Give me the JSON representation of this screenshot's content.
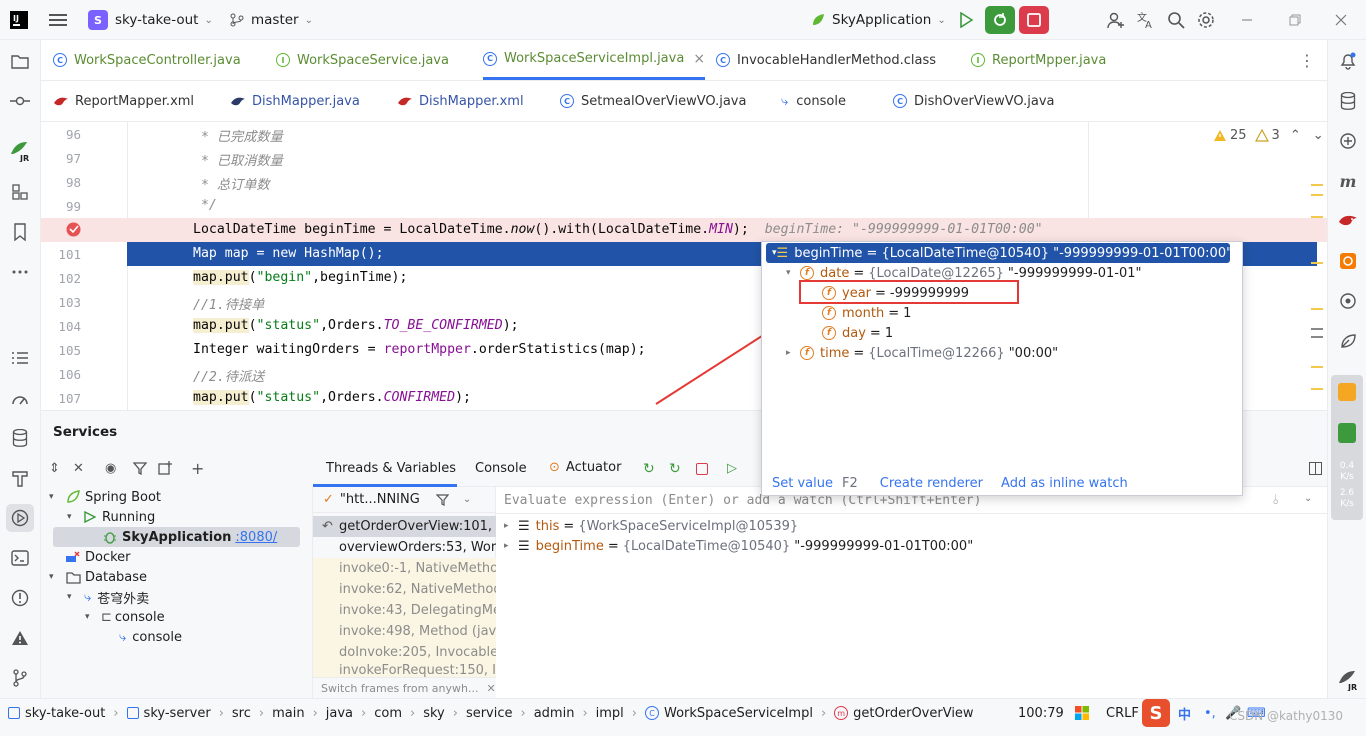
{
  "titlebar": {
    "project_badge": "S",
    "project_name": "sky-take-out",
    "branch": "master",
    "run_config": "SkyApplication"
  },
  "tabs_row1": [
    {
      "label": "WorkSpaceController.java",
      "icon": "class-icon"
    },
    {
      "label": "WorkSpaceService.java",
      "icon": "interface-icon"
    },
    {
      "label": "WorkSpaceServiceImpl.java",
      "icon": "class-icon",
      "active": true,
      "close": "×"
    },
    {
      "label": "InvocableHandlerMethod.class",
      "icon": "class-icon"
    },
    {
      "label": "ReportMpper.java",
      "icon": "interface-icon"
    }
  ],
  "tabs_row2": [
    {
      "label": "ReportMapper.xml",
      "icon": "mybatis-icon"
    },
    {
      "label": "DishMapper.java",
      "icon": "mybatis-icon"
    },
    {
      "label": "DishMapper.xml",
      "icon": "mybatis-icon"
    },
    {
      "label": "SetmealOverViewVO.java",
      "icon": "class-icon"
    },
    {
      "label": "console",
      "icon": "console-icon"
    },
    {
      "label": "DishOverViewVO.java",
      "icon": "class-icon"
    }
  ],
  "inspections": {
    "warnings": "25",
    "weak": "3"
  },
  "editor": {
    "line_numbers": [
      "96",
      "97",
      "98",
      "99",
      "",
      "101",
      "102",
      "103",
      "104",
      "105",
      "106",
      "107"
    ],
    "lines": {
      "l96": " * 已完成数量",
      "l97": " * 已取消数量",
      "l98": " * 总订单数",
      "l99": " */",
      "l100_a": "LocalDateTime beginTime = LocalDateTime.",
      "l100_now": "now",
      "l100_b": "().with(LocalDateTime.",
      "l100_min": "MIN",
      "l100_c": ");",
      "l100_inline": "beginTime: \"-999999999-01-01T00:00\"",
      "l101": "Map map = new HashMap();",
      "l102_put": "map.put",
      "l102_a": "(",
      "l102_str": "\"begin\"",
      "l102_b": ",beginTime);",
      "l103": "//1.待接单",
      "l104_put": "map.put",
      "l104_a": "(",
      "l104_str": "\"status\"",
      "l104_b": ",Orders.",
      "l104_c": "TO_BE_CONFIRMED",
      "l104_d": ");",
      "l105_a": "Integer waitingOrders = ",
      "l105_b": "reportMpper",
      "l105_c": ".orderStatistics(map);",
      "l106": "//2.待派送",
      "l107_put": "map.put",
      "l107_a": "(",
      "l107_str": "\"status\"",
      "l107_b": ",Orders.",
      "l107_c": "CONFIRMED",
      "l107_d": ");"
    }
  },
  "popup": {
    "root": "beginTime = {LocalDateTime@10540} \"-999999999-01-01T00:00\"",
    "date_name": "date",
    "date_type": "{LocalDate@12265}",
    "date_val": "\"-999999999-01-01\"",
    "year_name": "year",
    "year_val": "-999999999",
    "month_name": "month",
    "month_val": "1",
    "day_name": "day",
    "day_val": "1",
    "time_name": "time",
    "time_type": "{LocalTime@12266}",
    "time_val": "\"00:00\"",
    "eq": "=",
    "set_value": "Set value",
    "set_value_key": "F2",
    "create_renderer": "Create renderer",
    "add_inline": "Add as inline watch"
  },
  "services": {
    "title": "Services",
    "tree": {
      "spring_boot": "Spring Boot",
      "running": "Running",
      "app": "SkyApplication",
      "port": ":8080/",
      "docker": "Docker",
      "database": "Database",
      "ds": "苍穹外卖",
      "console_group": "console",
      "console": "console"
    }
  },
  "debugger": {
    "tab_threads": "Threads & Variables",
    "tab_console": "Console",
    "tab_actuator": "Actuator",
    "thread_selector": "\"htt...NNING",
    "eval_placeholder": "Evaluate expression (Enter) or add a watch (Ctrl+Shift+Enter)",
    "frames": [
      "getOrderOverView:101, W",
      "overviewOrders:53, Work",
      "invoke0:-1, NativeMethod",
      "invoke:62, NativeMethod",
      "invoke:43, DelegatingMe",
      "invoke:498, Method (java",
      "doInvoke:205, Invocable",
      "invokeForRequest:150, In"
    ],
    "frames_hint": "Switch frames from anywh...",
    "vars": [
      {
        "name": "this",
        "type": "{WorkSpaceServiceImpl@10539}",
        "value": ""
      },
      {
        "name": "beginTime",
        "type": "{LocalDateTime@10540}",
        "value": "\"-999999999-01-01T00:00\""
      }
    ],
    "var_eq": "="
  },
  "statusbar": {
    "crumbs": [
      "sky-take-out",
      "sky-server",
      "src",
      "main",
      "java",
      "com",
      "sky",
      "service",
      "admin",
      "impl",
      "WorkSpaceServiceImpl",
      "getOrderOverView"
    ],
    "position": "100:79",
    "line_sep": "CRLF",
    "ime": "中",
    "watermark": "CSDN @kathy0130",
    "speed1": "0.4",
    "speed2": "2.6",
    "speed_unit": "K/s"
  },
  "colors": {
    "accent": "#3574f0",
    "selection": "#2154a8",
    "breakpoint_line": "#fae3e3",
    "annotation_red": "#e53935"
  }
}
